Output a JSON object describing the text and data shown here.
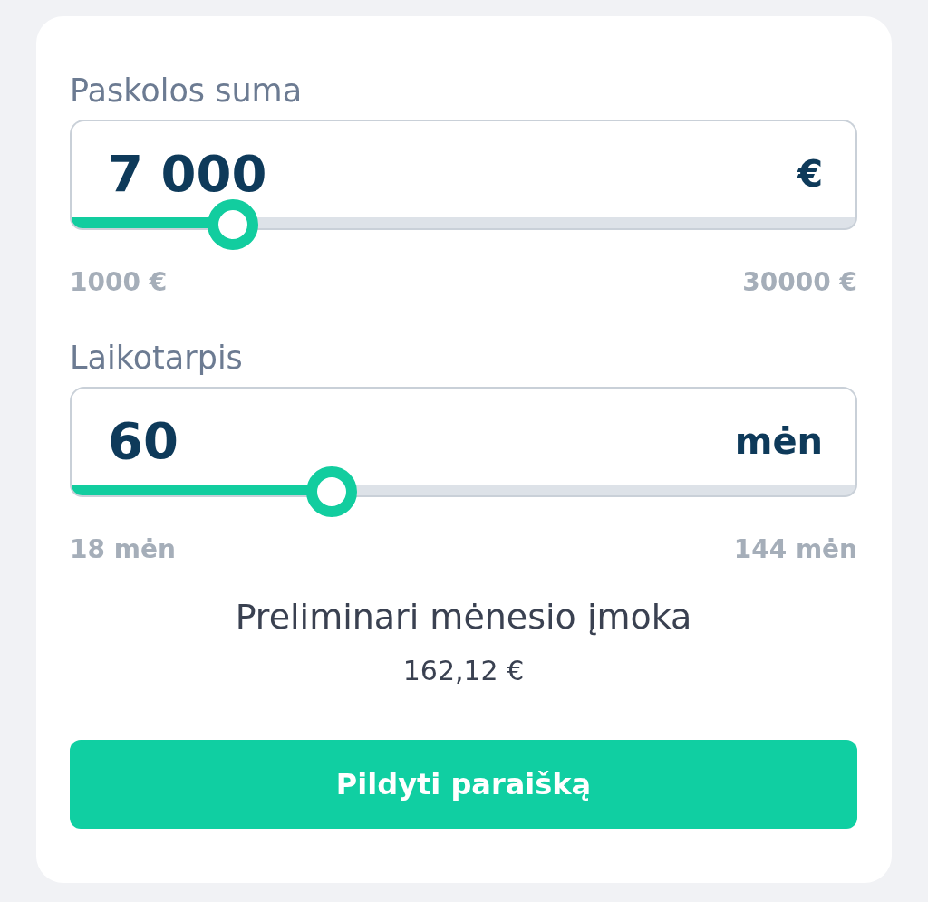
{
  "sliders": [
    {
      "label": "Paskolos suma",
      "value": "7 000",
      "unit": "€",
      "level": 0.207,
      "min_label": "1000 €",
      "max_label": "30000 €"
    },
    {
      "label": "Laikotarpis",
      "value": "60",
      "unit": "mėn",
      "level": 0.333,
      "min_label": "18 mėn",
      "max_label": "144 mėn"
    }
  ],
  "summary": {
    "title": "Preliminari mėnesio įmoka",
    "amount": "162,12 €"
  },
  "button": {
    "label": "Pildyti paraišką"
  }
}
